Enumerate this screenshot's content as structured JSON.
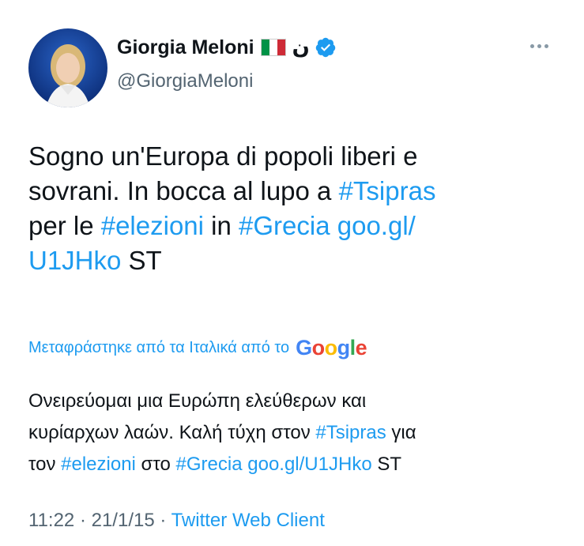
{
  "author": {
    "name": "Giorgia Meloni",
    "nun": "ن",
    "handle": "@GiorgiaMeloni"
  },
  "tweet": {
    "lines": [
      [
        {
          "text": "Sogno un'Europa di popoli liberi e",
          "link": false
        }
      ],
      [
        {
          "text": "sovrani. In bocca al lupo a ",
          "link": false
        },
        {
          "text": "#Tsipras",
          "link": true
        }
      ],
      [
        {
          "text": "per le ",
          "link": false
        },
        {
          "text": "#elezioni",
          "link": true
        },
        {
          "text": " in ",
          "link": false
        },
        {
          "text": "#Grecia",
          "link": true
        },
        {
          "text": " ",
          "link": false
        },
        {
          "text": "goo.gl/",
          "link": true
        }
      ],
      [
        {
          "text": "U1JHko",
          "link": true
        },
        {
          "text": " ST",
          "link": false
        }
      ]
    ]
  },
  "translation": {
    "label": "Μεταφράστηκε από τα Ιταλικά από το",
    "provider": "Google",
    "lines": [
      [
        {
          "text": "Ονειρεύομαι μια Ευρώπη ελεύθερων και",
          "link": false
        }
      ],
      [
        {
          "text": "κυρίαρχων λαών. Καλή τύχη στον ",
          "link": false
        },
        {
          "text": "#Tsipras",
          "link": true
        },
        {
          "text": " για",
          "link": false
        }
      ],
      [
        {
          "text": "τον ",
          "link": false
        },
        {
          "text": "#elezioni",
          "link": true
        },
        {
          "text": " στο ",
          "link": false
        },
        {
          "text": "#Grecia",
          "link": true
        },
        {
          "text": " ",
          "link": false
        },
        {
          "text": "goo.gl/U1JHko",
          "link": true
        },
        {
          "text": " ST",
          "link": false
        }
      ]
    ]
  },
  "meta": {
    "time": "11:22",
    "sep1": " · ",
    "date": "21/1/15",
    "sep2": " · ",
    "source": "Twitter Web Client"
  },
  "colors": {
    "link": "#1d9bf0",
    "secondary": "#536471",
    "verified": "#1d9bf0"
  },
  "icons": {
    "verified": "verified-badge-icon",
    "more": "more-options-icon",
    "flag": "italy-flag-icon"
  }
}
